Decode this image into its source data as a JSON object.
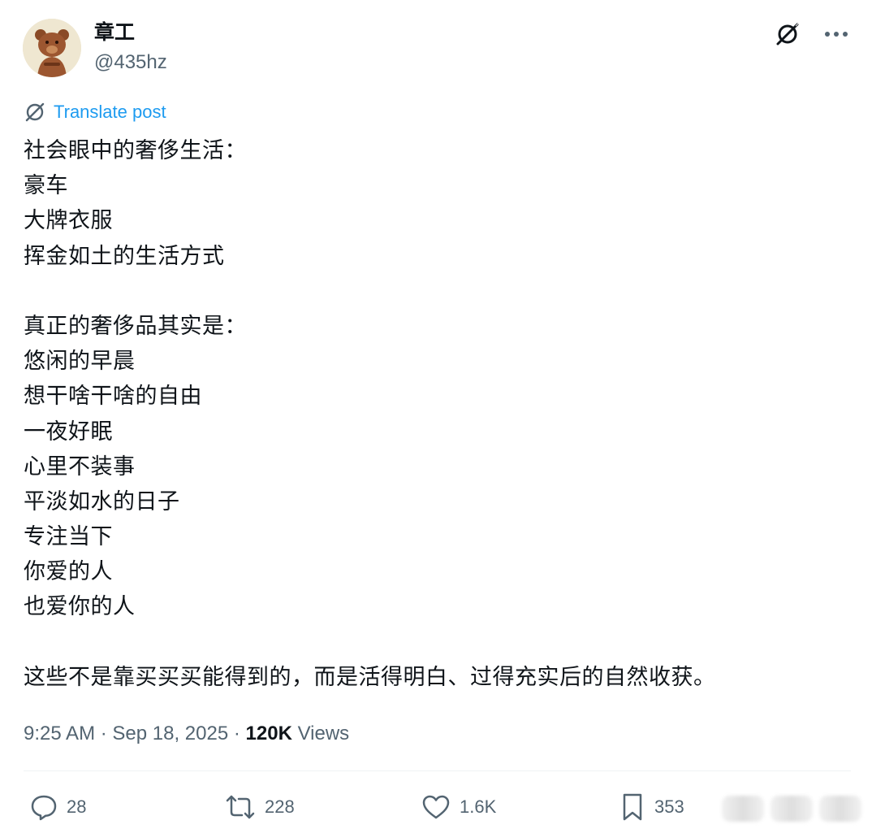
{
  "author": {
    "name": "章工",
    "handle": "@435hz"
  },
  "icons": {
    "grok": "grok-icon",
    "more": "more-icon",
    "translate": "translate-icon",
    "reply": "reply-icon",
    "repost": "repost-icon",
    "like": "like-icon",
    "bookmark": "bookmark-icon"
  },
  "translate_label": "Translate post",
  "post_lines": [
    "社会眼中的奢侈生活：",
    "豪车",
    "大牌衣服",
    "挥金如土的生活方式",
    "",
    "真正的奢侈品其实是：",
    "悠闲的早晨",
    "想干啥干啥的自由",
    "一夜好眠",
    "心里不装事",
    "平淡如水的日子",
    "专注当下",
    "你爱的人",
    "也爱你的人",
    "",
    "这些不是靠买买买能得到的，而是活得明白、过得充实后的自然收获。"
  ],
  "meta": {
    "time": "9:25 AM",
    "date": "Sep 18, 2025",
    "views_count": "120K",
    "views_label": "Views"
  },
  "actions": {
    "replies": "28",
    "reposts": "228",
    "likes": "1.6K",
    "bookmarks": "353"
  },
  "colors": {
    "link": "#1d9bf0",
    "secondary_text": "#536471",
    "primary_text": "#0f1419"
  }
}
